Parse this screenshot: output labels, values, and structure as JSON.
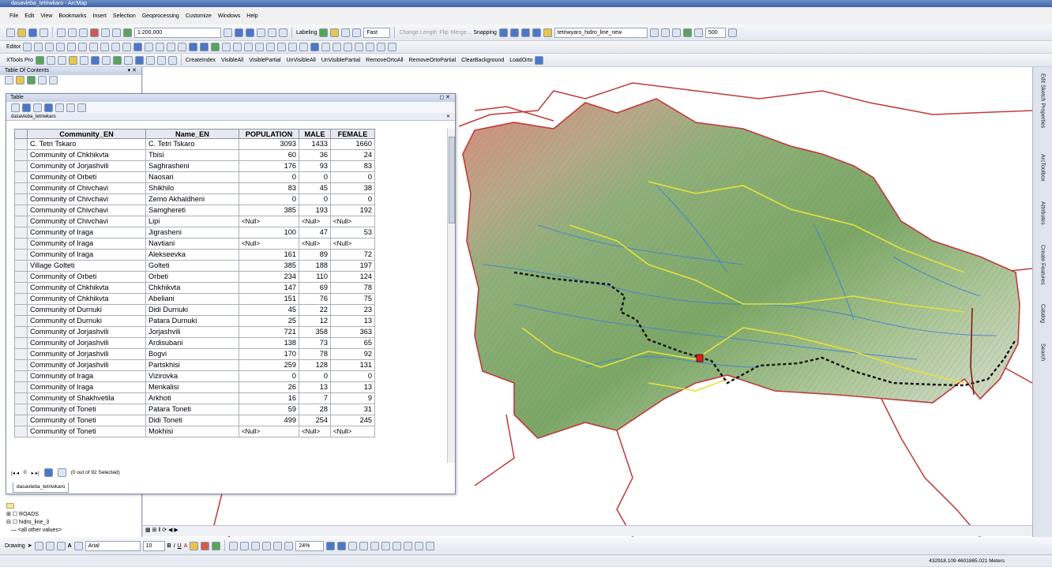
{
  "window": {
    "title": "dasavleba_tetriwkaro - ArcMap"
  },
  "menu": [
    "File",
    "Edit",
    "View",
    "Bookmarks",
    "Insert",
    "Selection",
    "Geoprocessing",
    "Customize",
    "Windows",
    "Help"
  ],
  "toolbar1": {
    "scale": "1:200,000",
    "labeling": "Labeling",
    "fast": "Fast",
    "change_length": "Change Length",
    "flip": "Flip",
    "merge": "Merge...",
    "snapping": "Snapping",
    "layer_combo": "tetriwyaro_hidro_line_new",
    "zoom_val": "500"
  },
  "toolbar2": {
    "editor": "Editor"
  },
  "toolbar3": {
    "xtools": "XTools Pro",
    "buttons": [
      "CreateIndex",
      "VisibleAll",
      "VisiblePartial",
      "UnVisibleAll",
      "UnVisiblePartial",
      "RemoveOrtoAll",
      "RemoveOrtoPartial",
      "ClearBackground",
      "LoadOrto"
    ]
  },
  "toc": {
    "title": "Table Of Contents",
    "items": [
      "ROADS",
      "hidro_line_3",
      "<all other values>"
    ]
  },
  "table_window": {
    "title": "Table",
    "layer_tab": "dasavleba_tetriwkaro",
    "columns": [
      "Community_EN",
      "Name_EN",
      "POPULATION",
      "MALE",
      "FEMALE"
    ],
    "rows": [
      [
        "C. Tetri Tskaro",
        "C. Tetri Tskaro",
        "3093",
        "1433",
        "1660"
      ],
      [
        "Community of Chkhikvta",
        "Tbisi",
        "60",
        "36",
        "24"
      ],
      [
        "Community of Jorjashvili",
        "Saghrasheni",
        "176",
        "93",
        "83"
      ],
      [
        "Community of Orbeti",
        "Naosari",
        "0",
        "0",
        "0"
      ],
      [
        "Community of Chivchavi",
        "Shikhilo",
        "83",
        "45",
        "38"
      ],
      [
        "Community of Chivchavi",
        "Zemo Akhaldheni",
        "0",
        "0",
        "0"
      ],
      [
        "Community of Chivchavi",
        "Samghereti",
        "385",
        "193",
        "192"
      ],
      [
        "Community of Chivchavi",
        "Lipi",
        "<Null>",
        "<Null>",
        "<Null>"
      ],
      [
        "Community of Iraga",
        "Jigrasheni",
        "100",
        "47",
        "53"
      ],
      [
        "Community of Iraga",
        "Navtiani",
        "<Null>",
        "<Null>",
        "<Null>"
      ],
      [
        "Community of Iraga",
        "Alekseevka",
        "161",
        "89",
        "72"
      ],
      [
        "Village Golteti",
        "Golteti",
        "385",
        "188",
        "197"
      ],
      [
        "Community of Orbeti",
        "Orbeti",
        "234",
        "110",
        "124"
      ],
      [
        "Community of Chkhikvta",
        "Chkhikvta",
        "147",
        "69",
        "78"
      ],
      [
        "Community of Chkhikvta",
        "Abeliani",
        "151",
        "76",
        "75"
      ],
      [
        "Community of Durnuki",
        "Didi Durnuki",
        "45",
        "22",
        "23"
      ],
      [
        "Community of Durnuki",
        "Patara Durnuki",
        "25",
        "12",
        "13"
      ],
      [
        "Community of Jorjashvili",
        "Jorjashvili",
        "721",
        "358",
        "363"
      ],
      [
        "Community of Jorjashvili",
        "Ardisubani",
        "138",
        "73",
        "65"
      ],
      [
        "Community of Jorjashvili",
        "Bogvi",
        "170",
        "78",
        "92"
      ],
      [
        "Community of Jorjashvili",
        "Partskhisi",
        "259",
        "128",
        "131"
      ],
      [
        "Community of Iraga",
        "Vizirovka",
        "0",
        "0",
        "0"
      ],
      [
        "Community of Iraga",
        "Menkalisi",
        "26",
        "13",
        "13"
      ],
      [
        "Community of Shakhvetila",
        "Arkhoti",
        "16",
        "7",
        "9"
      ],
      [
        "Community of Toneti",
        "Patara Toneti",
        "59",
        "28",
        "31"
      ],
      [
        "Community of Toneti",
        "Didi Toneti",
        "499",
        "254",
        "245"
      ],
      [
        "Community of Toneti",
        "Mokhisi",
        "<Null>",
        "<Null>",
        "<Null>"
      ]
    ],
    "record_nav": "0",
    "selection_status": "(0 out of 92 Selected)",
    "bottom_tab": "dasavleba_tetriwkaro"
  },
  "right_dock": [
    "Edit Sketch Properties",
    "ArcToolbox",
    "Attributes",
    "Create Features",
    "Catalog",
    "Search"
  ],
  "drawing_toolbar": {
    "label": "Drawing",
    "font": "Arial",
    "size": "10",
    "zoom": "24%"
  },
  "status": {
    "coords": "432918.109  4601865.021 Meters"
  },
  "colors": {
    "accent": "#3e63aa",
    "boundary": "#c0393b",
    "roads": "#e6e23a",
    "rivers": "#3f7fd9"
  }
}
